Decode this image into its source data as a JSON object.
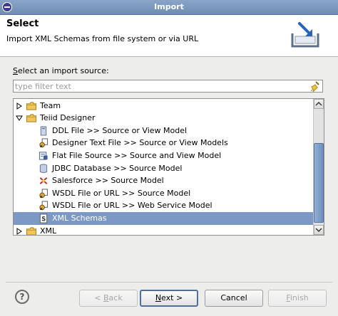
{
  "window": {
    "title": "Import"
  },
  "header": {
    "title": "Select",
    "description": "Import XML Schemas from file system or via URL"
  },
  "source_label": {
    "mnemonic": "S",
    "rest": "elect an import source:"
  },
  "filter": {
    "value": "",
    "placeholder": "type filter text"
  },
  "tree": {
    "items": [
      {
        "label": "Team",
        "level": 0,
        "expanded": false,
        "icon": "folder-icon"
      },
      {
        "label": "Teiid Designer",
        "level": 0,
        "expanded": true,
        "icon": "folder-icon"
      },
      {
        "label": "DDL File >> Source or View Model",
        "level": 1,
        "icon": "ddl-file-icon"
      },
      {
        "label": "Designer Text File >> Source or View Models",
        "level": 1,
        "icon": "text-import-icon"
      },
      {
        "label": "Flat File Source >> Source and View Model",
        "level": 1,
        "icon": "flat-file-icon"
      },
      {
        "label": "JDBC Database >> Source Model",
        "level": 1,
        "icon": "database-icon"
      },
      {
        "label": "Salesforce >> Source Model",
        "level": 1,
        "icon": "salesforce-icon"
      },
      {
        "label": "WSDL File or URL >> Source Model",
        "level": 1,
        "icon": "wsdl-icon"
      },
      {
        "label": "WSDL File or URL >> Web Service Model",
        "level": 1,
        "icon": "wsdl-icon"
      },
      {
        "label": "XML Schemas",
        "level": 1,
        "icon": "xml-schema-icon",
        "selected": true
      },
      {
        "label": "XML",
        "level": 0,
        "expanded": false,
        "icon": "folder-icon"
      }
    ]
  },
  "buttons": {
    "help": "?",
    "back": {
      "mnemonic": "B",
      "rest": "ack",
      "prefix": "< "
    },
    "next": {
      "mnemonic": "N",
      "rest": "ext >"
    },
    "cancel": "Cancel",
    "finish": {
      "mnemonic": "F",
      "rest": "inish"
    }
  },
  "colors": {
    "selection": "#7b99c4",
    "titlebar": "#7a97bf",
    "scroll_thumb": "#7b99c4"
  }
}
